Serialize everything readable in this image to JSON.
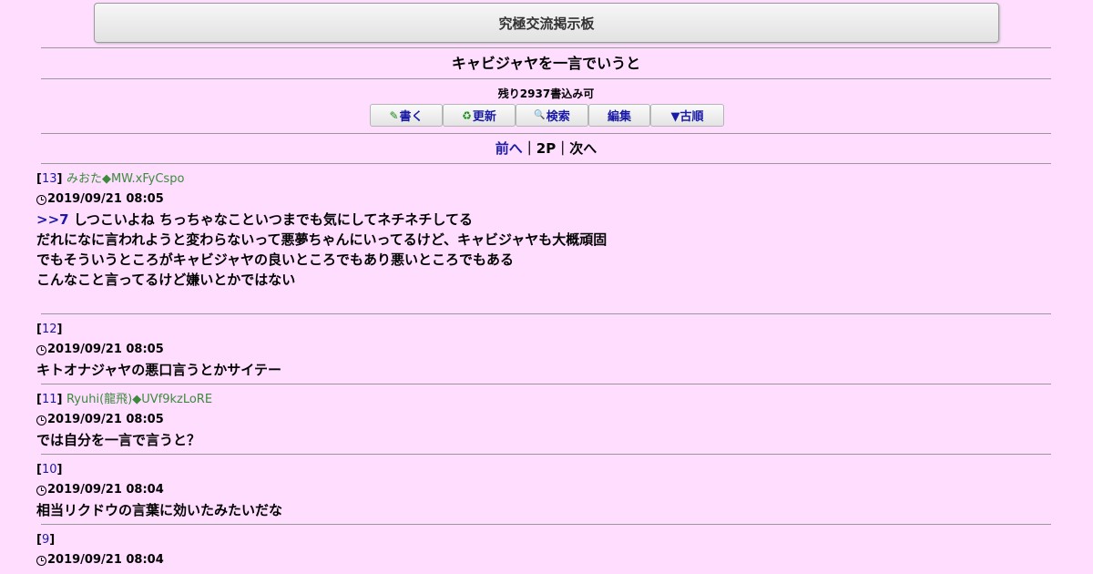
{
  "header": {
    "title": "究極交流掲示板"
  },
  "thread": {
    "title": "キャビジャヤを一言でいうと",
    "remaining": "残り2937書込み可"
  },
  "toolbar": {
    "buttons": [
      {
        "icon": "✎",
        "label": "書く"
      },
      {
        "icon": "♻",
        "label": "更新"
      },
      {
        "icon": "🔍",
        "label": "検索"
      },
      {
        "icon": "",
        "label": "編集"
      },
      {
        "icon": "",
        "label": "▼古順"
      }
    ]
  },
  "pager": {
    "prev": "前へ",
    "current": "2P",
    "next": "次へ",
    "sep": "｜"
  },
  "posts": [
    {
      "num": "13",
      "name": "みおた◆MW.xFyCspo",
      "date": "2019/09/21 08:05",
      "anchor": ">>7",
      "lines": [
        "しつこいよね ちっちゃなこといつまでも気にしてネチネチしてる",
        "だれになに言われようと変わらないって悪夢ちゃんにいってるけど、キャビジャヤも大概頑固",
        "でもそういうところがキャビジャヤの良いところでもあり悪いところでもある",
        "こんなこと言ってるけど嫌いとかではない"
      ]
    },
    {
      "num": "12",
      "name": "",
      "date": "2019/09/21 08:05",
      "lines": [
        "キトオナジャヤの悪口言うとかサイテー"
      ]
    },
    {
      "num": "11",
      "name": "Ryuhi(龍飛)◆UVf9kzLoRE",
      "date": "2019/09/21 08:05",
      "lines": [
        "では自分を一言で言うと？"
      ]
    },
    {
      "num": "10",
      "name": "",
      "date": "2019/09/21 08:04",
      "lines": [
        "相当リクドウの言葉に効いたみたいだな"
      ]
    },
    {
      "num": "9",
      "name": "",
      "date": "2019/09/21 08:04",
      "lines": []
    }
  ]
}
